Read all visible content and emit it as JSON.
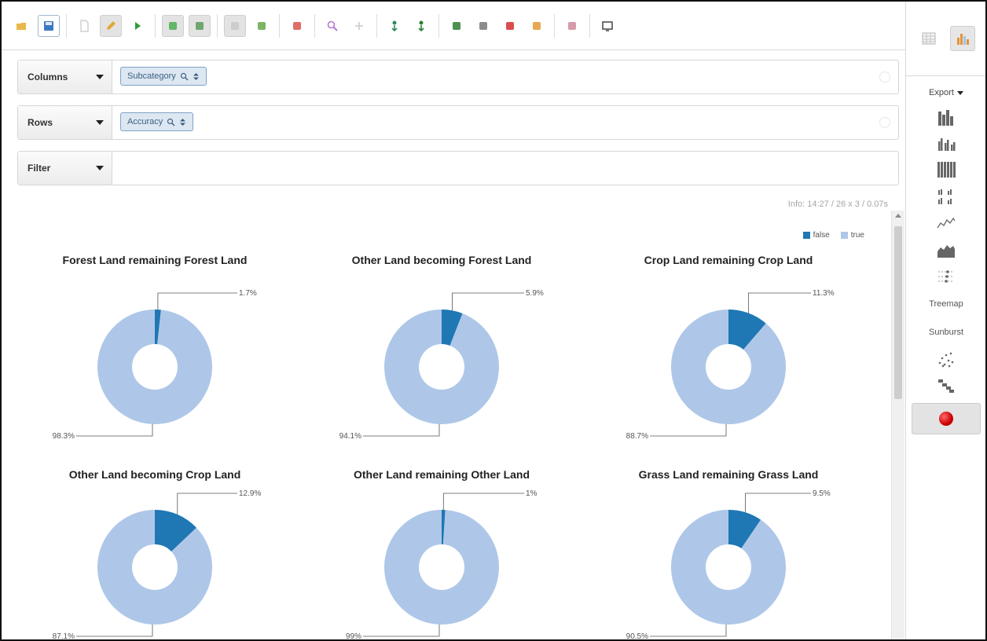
{
  "toolbar": {
    "buttons": [
      {
        "name": "open-folder-icon",
        "color": "#e8b84a",
        "state": ""
      },
      {
        "name": "save-icon",
        "color": "#3b78c2",
        "state": "sel"
      },
      {
        "name": "new-document-icon",
        "color": "#bbbbbb",
        "state": ""
      },
      {
        "name": "edit-pencil-icon",
        "color": "#e0a83a",
        "state": "active"
      },
      {
        "name": "run-play-icon",
        "color": "#2e9c3a",
        "state": ""
      },
      {
        "name": "auto-run-icon",
        "color": "#4caf50",
        "state": "active"
      },
      {
        "name": "non-empty-icon",
        "color": "#5c9a5c",
        "state": "active"
      },
      {
        "name": "swap-axes-icon",
        "color": "#c9c9c9",
        "state": "active"
      },
      {
        "name": "show-parent-icon",
        "color": "#67a84a",
        "state": ""
      },
      {
        "name": "hide-parent-icon",
        "color": "#d9534f",
        "state": ""
      },
      {
        "name": "zoom-icon",
        "color": "#b57bd1",
        "state": ""
      },
      {
        "name": "drill-across-icon",
        "color": "#c8c8c8",
        "state": ""
      },
      {
        "name": "drill-member-icon",
        "color": "#2e8b57",
        "state": ""
      },
      {
        "name": "drill-position-icon",
        "color": "#2e7d32",
        "state": ""
      },
      {
        "name": "export-xls-icon",
        "color": "#2e7d32",
        "state": ""
      },
      {
        "name": "export-csv-icon",
        "color": "#777777",
        "state": ""
      },
      {
        "name": "export-pdf-icon",
        "color": "#d32f2f",
        "state": ""
      },
      {
        "name": "edit-query-icon",
        "color": "#e09a30",
        "state": ""
      },
      {
        "name": "tag-icon",
        "color": "#d08a9a",
        "state": ""
      },
      {
        "name": "show-chart-icon",
        "color": "#444444",
        "state": ""
      }
    ]
  },
  "side_panel": {
    "top_buttons": [
      {
        "name": "table-view-icon"
      },
      {
        "name": "chart-view-icon"
      }
    ],
    "export_label": "Export",
    "chart_types": [
      {
        "name": "stacked-bar-chart-icon",
        "kind": "icon"
      },
      {
        "name": "grouped-bar-chart-icon",
        "kind": "icon"
      },
      {
        "name": "stacked-100-bar-chart-icon",
        "kind": "icon"
      },
      {
        "name": "multiple-bar-chart-icon",
        "kind": "icon"
      },
      {
        "name": "line-chart-icon",
        "kind": "icon"
      },
      {
        "name": "area-chart-icon",
        "kind": "icon"
      },
      {
        "name": "dot-chart-icon",
        "kind": "icon"
      },
      {
        "name": "treemap-option",
        "kind": "text",
        "label": "Treemap"
      },
      {
        "name": "sunburst-option",
        "kind": "text",
        "label": "Sunburst"
      },
      {
        "name": "scatter-chart-icon",
        "kind": "icon"
      },
      {
        "name": "waterfall-chart-icon",
        "kind": "icon"
      },
      {
        "name": "pie-chart-record-icon",
        "kind": "record"
      }
    ]
  },
  "drop_zones": {
    "columns": {
      "label": "Columns",
      "pill": "Subcategory"
    },
    "rows": {
      "label": "Rows",
      "pill": "Accuracy"
    },
    "filter": {
      "label": "Filter"
    }
  },
  "info_text": "Info: 14:27   /  26 x 3  /  0.07s",
  "legend": [
    {
      "label": "false",
      "color": "#1f77b4"
    },
    {
      "label": "true",
      "color": "#aec7e8"
    }
  ],
  "chart_data": [
    {
      "type": "pie",
      "title": "Forest Land remaining Forest Land",
      "labels": [
        "false",
        "true"
      ],
      "values": [
        1.7,
        98.3
      ],
      "value_labels": [
        "1.7%",
        "98.3%"
      ]
    },
    {
      "type": "pie",
      "title": "Other Land becoming Forest Land",
      "labels": [
        "false",
        "true"
      ],
      "values": [
        5.9,
        94.1
      ],
      "value_labels": [
        "5.9%",
        "94.1%"
      ]
    },
    {
      "type": "pie",
      "title": "Crop Land remaining Crop Land",
      "labels": [
        "false",
        "true"
      ],
      "values": [
        11.3,
        88.7
      ],
      "value_labels": [
        "11.3%",
        "88.7%"
      ]
    },
    {
      "type": "pie",
      "title": "Other Land becoming Crop Land",
      "labels": [
        "false",
        "true"
      ],
      "values": [
        12.9,
        87.1
      ],
      "value_labels": [
        "12.9%",
        "87.1%"
      ]
    },
    {
      "type": "pie",
      "title": "Other Land remaining Other Land",
      "labels": [
        "false",
        "true"
      ],
      "values": [
        1,
        99
      ],
      "value_labels": [
        "1%",
        "99%"
      ]
    },
    {
      "type": "pie",
      "title": "Grass Land remaining Grass Land",
      "labels": [
        "false",
        "true"
      ],
      "values": [
        9.5,
        90.5
      ],
      "value_labels": [
        "9.5%",
        "90.5%"
      ]
    }
  ]
}
